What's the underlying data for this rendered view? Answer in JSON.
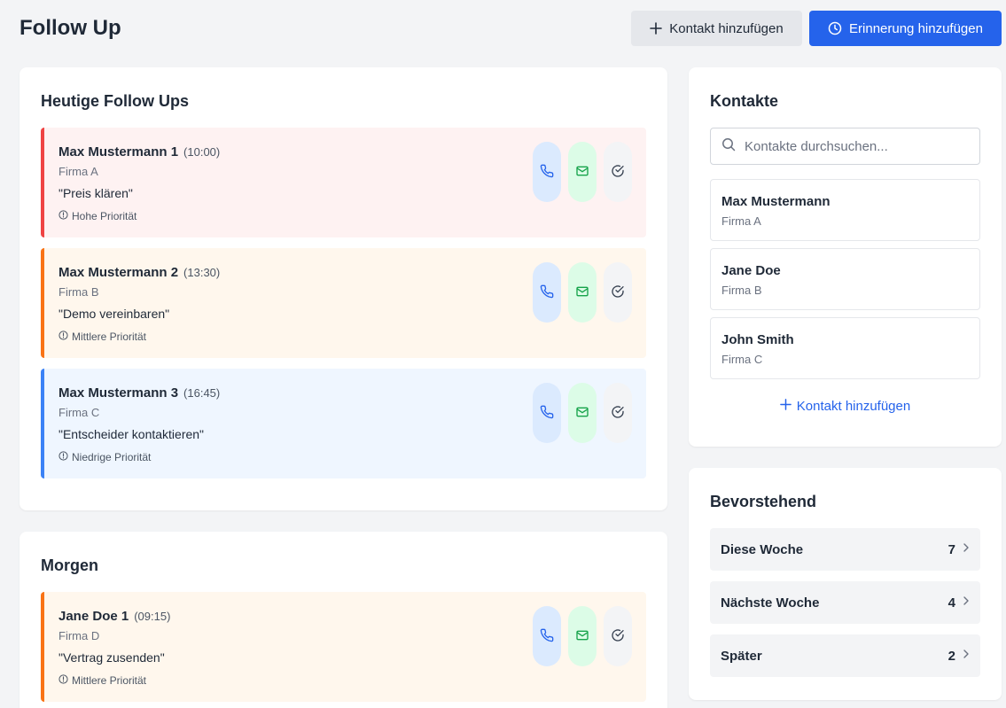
{
  "header": {
    "title": "Follow Up",
    "add_contact_label": "Kontakt hinzufügen",
    "add_reminder_label": "Erinnerung hinzufügen"
  },
  "today": {
    "title": "Heutige Follow Ups",
    "items": [
      {
        "name": "Max Mustermann 1",
        "time": "(10:00)",
        "company": "Firma A",
        "note": "\"Preis klären\"",
        "priority": "Hohe Priorität"
      },
      {
        "name": "Max Mustermann 2",
        "time": "(13:30)",
        "company": "Firma B",
        "note": "\"Demo vereinbaren\"",
        "priority": "Mittlere Priorität"
      },
      {
        "name": "Max Mustermann 3",
        "time": "(16:45)",
        "company": "Firma C",
        "note": "\"Entscheider kontaktieren\"",
        "priority": "Niedrige Priorität"
      }
    ]
  },
  "tomorrow": {
    "title": "Morgen",
    "items": [
      {
        "name": "Jane Doe 1",
        "time": "(09:15)",
        "company": "Firma D",
        "note": "\"Vertrag zusenden\"",
        "priority": "Mittlere Priorität"
      }
    ]
  },
  "contacts": {
    "title": "Kontakte",
    "search_placeholder": "Kontakte durchsuchen...",
    "items": [
      {
        "name": "Max Mustermann",
        "company": "Firma A"
      },
      {
        "name": "Jane Doe",
        "company": "Firma B"
      },
      {
        "name": "John Smith",
        "company": "Firma C"
      }
    ],
    "add_label": "Kontakt hinzufügen"
  },
  "upcoming": {
    "title": "Bevorstehend",
    "items": [
      {
        "label": "Diese Woche",
        "count": "7"
      },
      {
        "label": "Nächste Woche",
        "count": "4"
      },
      {
        "label": "Später",
        "count": "2"
      }
    ]
  },
  "colors": {
    "primary": "#2563eb",
    "priority_high": "#ef4444",
    "priority_medium": "#f97316",
    "priority_low": "#3b82f6",
    "call": "#2563eb",
    "mail": "#16a34a"
  }
}
